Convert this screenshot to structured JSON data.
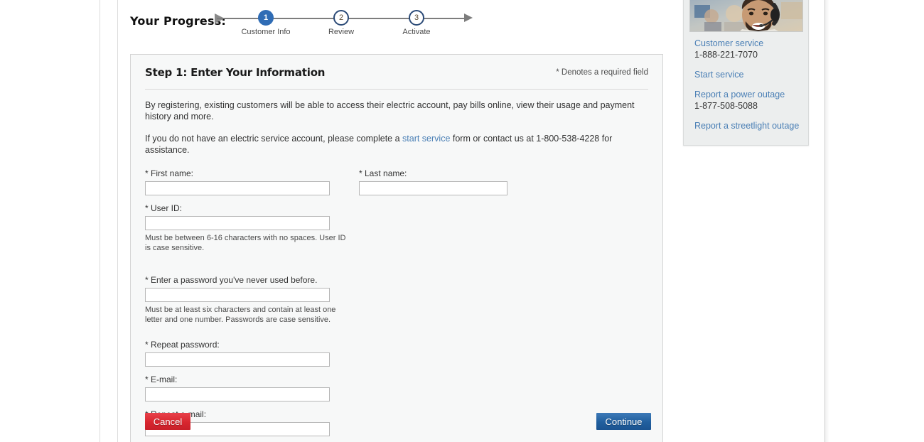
{
  "progress": {
    "label": "Your Progress:",
    "steps": [
      {
        "number": "1",
        "label": "Customer Info",
        "state": "active"
      },
      {
        "number": "2",
        "label": "Review",
        "state": "inactive"
      },
      {
        "number": "3",
        "label": "Activate",
        "state": "inactive"
      }
    ]
  },
  "form": {
    "title": "Step 1: Enter Your Information",
    "required_note": "* Denotes a required field",
    "intro_1": "By registering, existing customers will be able to access their electric account, pay bills online, view their usage and payment history and more.",
    "intro_2_before": "If you do not have an electric service account, please complete a ",
    "intro_2_link": "start service",
    "intro_2_after": " form or contact us at 1-800-538-4228 for assistance.",
    "fields": {
      "first_name": {
        "label": "* First name:",
        "value": "",
        "placeholder": ""
      },
      "last_name": {
        "label": "* Last name:",
        "value": "",
        "placeholder": ""
      },
      "user_id": {
        "label": "* User ID:",
        "value": "",
        "placeholder": "",
        "hint": "Must be between 6-16 characters with no spaces. User ID is case sensitive."
      },
      "password": {
        "label": "* Enter a password you've never used before.",
        "value": "",
        "placeholder": "",
        "hint": "Must be at least six characters and contain at least one letter and one number. Passwords are case sensitive."
      },
      "repeat_password": {
        "label": "* Repeat password:",
        "value": "",
        "placeholder": ""
      },
      "email": {
        "label": "* E-mail:",
        "value": "",
        "placeholder": ""
      },
      "repeat_email": {
        "label": "* Repeat e-mail:",
        "value": "",
        "placeholder": ""
      }
    },
    "buttons": {
      "cancel": "Cancel",
      "continue": "Continue"
    }
  },
  "sidebar": {
    "photo_alt": "customer-service-agent-photo",
    "groups": [
      {
        "link": "Customer service",
        "phone": "1-888-221-7070"
      },
      {
        "link": "Start service",
        "phone": ""
      },
      {
        "link": "Report a power outage",
        "phone": "1-877-508-5088"
      },
      {
        "link": "Report a streetlight outage",
        "phone": ""
      }
    ]
  },
  "colors": {
    "accent_blue": "#2f6cb5",
    "link_blue": "#4a7fb5",
    "cancel_red": "#d8262f",
    "continue_blue": "#215f9e",
    "panel_bg": "#f7f8f8",
    "sidebar_bg": "#eceeee"
  }
}
